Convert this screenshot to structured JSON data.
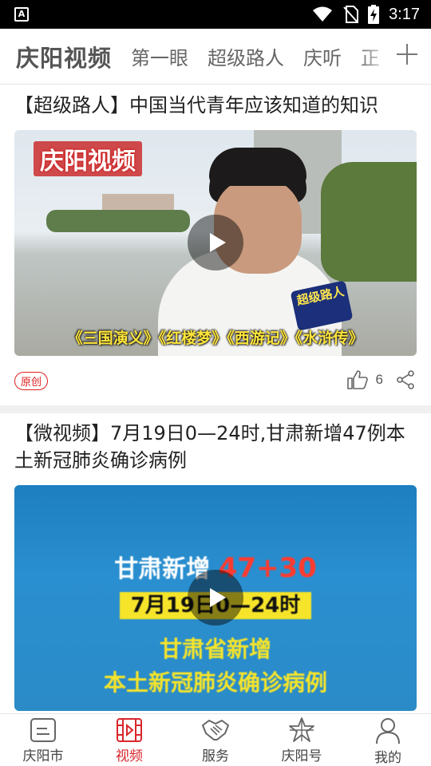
{
  "status_bar": {
    "time": "3:17",
    "notification_icon": "A"
  },
  "channel_bar": {
    "brand": "庆阳视频",
    "tabs": [
      "第一眼",
      "超级路人",
      "庆听",
      "正"
    ]
  },
  "feed": [
    {
      "title": "【超级路人】中国当代青年应该知道的知识",
      "thumbnail": {
        "logo": "庆阳视频",
        "mic_label": "超级路人",
        "subtitle": "《三国演义》《红楼梦》《西游记》《水浒传》"
      },
      "badge": "原创",
      "like_count": "6"
    },
    {
      "title": "【微视频】7月19日0—24时,甘肃新增47例本土新冠肺炎确诊病例",
      "thumbnail": {
        "line1_prefix": "甘肃新增",
        "line1_numbers": "47+30",
        "line2": "7月19日0—24时",
        "line3": "甘肃省新增",
        "line4": "本土新冠肺炎确诊病例"
      }
    }
  ],
  "bottom_nav": [
    {
      "label": "庆阳市",
      "icon": "news-icon"
    },
    {
      "label": "视频",
      "icon": "video-icon",
      "active": true
    },
    {
      "label": "服务",
      "icon": "handshake-icon"
    },
    {
      "label": "庆阳号",
      "icon": "star-emblem-icon"
    },
    {
      "label": "我的",
      "icon": "user-icon"
    }
  ],
  "colors": {
    "accent": "#d8262c"
  }
}
